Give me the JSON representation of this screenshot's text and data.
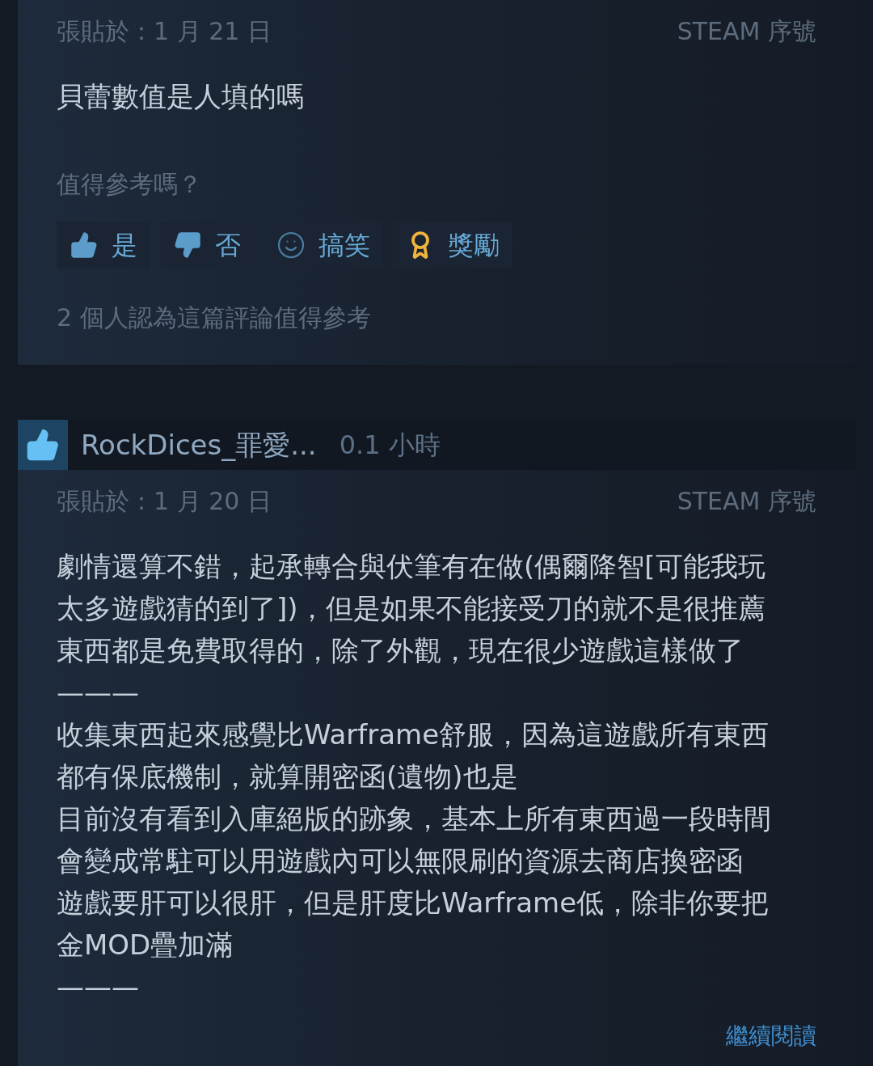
{
  "reviews": [
    {
      "posted": "張貼於：1 月 21 日",
      "source": "STEAM 序號",
      "lines": [
        "貝蕾數值是人填的嗎"
      ],
      "helpful_prompt": "值得參考嗎？",
      "votes": [
        {
          "kind": "up",
          "label": "是"
        },
        {
          "kind": "down",
          "label": "否"
        },
        {
          "kind": "funny",
          "label": "搞笑"
        },
        {
          "kind": "award",
          "label": "獎勵"
        }
      ],
      "helpful_count": "2 個人認為這篇評論值得參考"
    },
    {
      "recommended": true,
      "author": "RockDices_罪愛...",
      "hours": "0.1 小時",
      "posted": "張貼於：1 月 20 日",
      "source": "STEAM 序號",
      "lines": [
        "劇情還算不錯，起承轉合與伏筆有在做(偶爾降智[可能我玩",
        "太多遊戲猜的到了])，但是如果不能接受刀的就不是很推薦",
        "東西都是免費取得的，除了外觀，現在很少遊戲這樣做了",
        "———",
        "收集東西起來感覺比Warframe舒服，因為這遊戲所有東西",
        "都有保底機制，就算開密函(遺物)也是",
        "目前沒有看到入庫絕版的跡象，基本上所有東西過一段時間",
        "會變成常駐可以用遊戲內可以無限刷的資源去商店換密函",
        "遊戲要肝可以很肝，但是肝度比Warframe低，除非你要把",
        "金MOD疊加滿",
        "———"
      ],
      "read_more": "繼續閱讀"
    }
  ]
}
